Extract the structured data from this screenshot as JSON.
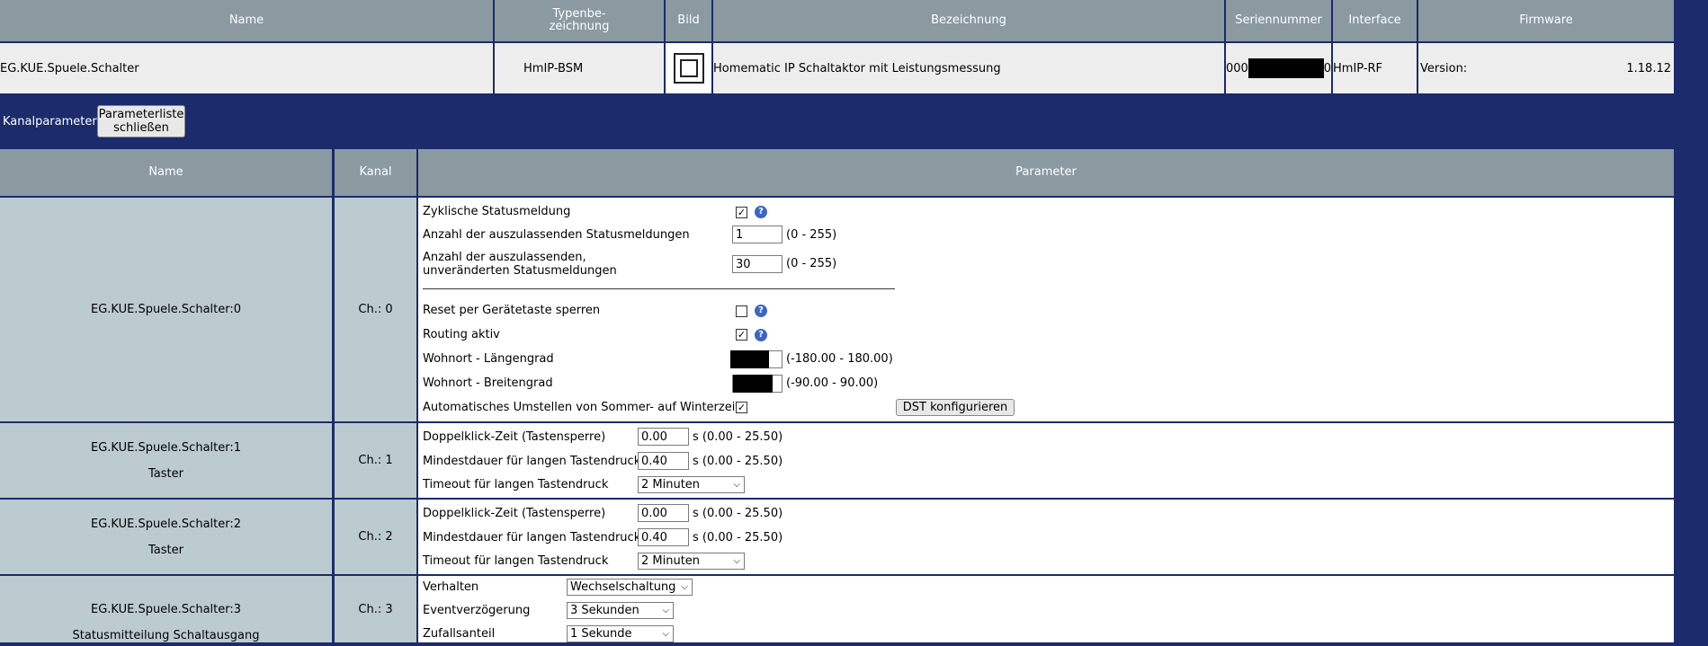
{
  "device_table": {
    "headers": [
      "Name",
      "Typenbe-\nzeichnung",
      "Bild",
      "Bezeichnung",
      "Seriennummer",
      "Interface",
      "Firmware"
    ],
    "row": {
      "name": "EG.KUE.Spuele.Schalter",
      "type": "HmIP-BSM",
      "description": "Homematic IP Schaltaktor mit Leistungsmessung",
      "serial_prefix": "000",
      "serial_suffix": "0",
      "interface": "HmIP-RF",
      "firmware_label": "Version:",
      "firmware_value": "1.18.12"
    }
  },
  "channel_bar": {
    "label": "Kanalparameter",
    "close_button": "Parameterliste\nschließen"
  },
  "param_table": {
    "headers": [
      "Name",
      "Kanal",
      "Parameter"
    ],
    "ch0": {
      "name": "EG.KUE.Spuele.Schalter:0",
      "channel": "Ch.: 0",
      "cyclic_label": "Zyklische Statusmeldung",
      "skip_label": "Anzahl der auszulassenden Statusmeldungen",
      "skip_value": "1",
      "skip_range": "(0 - 255)",
      "skip_unchanged_label": "Anzahl der auszulassenden,\nunveränderten Statusmeldungen",
      "skip_unchanged_value": "30",
      "skip_unchanged_range": "(0 - 255)",
      "reset_lock_label": "Reset per Gerätetaste sperren",
      "routing_label": "Routing aktiv",
      "longitude_label": "Wohnort - Längengrad",
      "longitude_range": "(-180.00 - 180.00)",
      "latitude_label": "Wohnort - Breitengrad",
      "latitude_range": "(-90.00 - 90.00)",
      "dst_label": "Automatisches Umstellen von Sommer- auf Winterzeit",
      "dst_button": "DST konfigurieren"
    },
    "ch1": {
      "name": "EG.KUE.Spuele.Schalter:1",
      "sub": "Taster",
      "channel": "Ch.: 1",
      "dbl_label": "Doppelklick-Zeit (Tastensperre)",
      "dbl_value": "0.00",
      "dbl_range": "s (0.00 - 25.50)",
      "min_label": "Mindestdauer für langen Tastendruck",
      "min_value": "0.40",
      "min_range": "s (0.00 - 25.50)",
      "timeout_label": "Timeout für langen Tastendruck",
      "timeout_value": "2 Minuten"
    },
    "ch2": {
      "name": "EG.KUE.Spuele.Schalter:2",
      "sub": "Taster",
      "channel": "Ch.: 2",
      "dbl_label": "Doppelklick-Zeit (Tastensperre)",
      "dbl_value": "0.00",
      "dbl_range": "s (0.00 - 25.50)",
      "min_label": "Mindestdauer für langen Tastendruck",
      "min_value": "0.40",
      "min_range": "s (0.00 - 25.50)",
      "timeout_label": "Timeout für langen Tastendruck",
      "timeout_value": "2 Minuten"
    },
    "ch3": {
      "name": "EG.KUE.Spuele.Schalter:3",
      "sub": "Statusmitteilung Schaltausgang",
      "channel": "Ch.: 3",
      "behavior_label": "Verhalten",
      "behavior_value": "Wechselschaltung",
      "delay_label": "Eventverzögerung",
      "delay_value": "3 Sekunden",
      "random_label": "Zufallsanteil",
      "random_value": "1 Sekunde"
    }
  },
  "colors": {
    "background": "#1b2b6b",
    "header": "#8a9aa0",
    "label_cell": "#bccbd0",
    "help": "#3a66c4"
  }
}
